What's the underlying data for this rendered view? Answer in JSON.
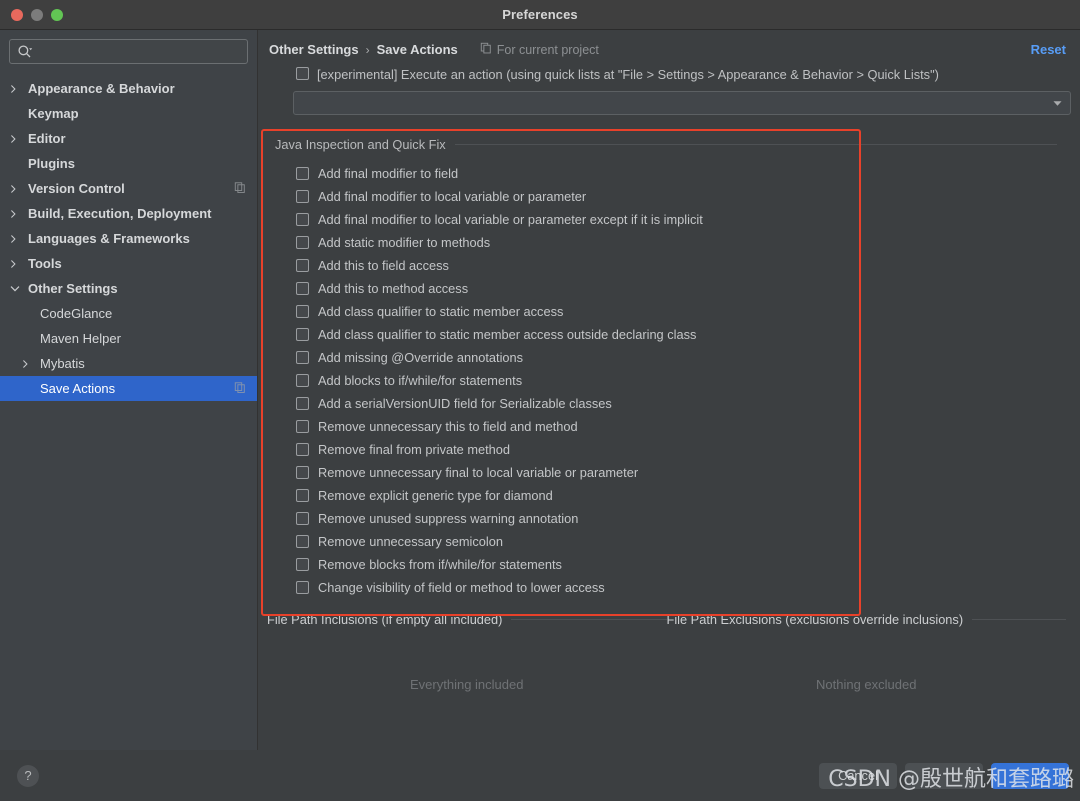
{
  "window": {
    "title": "Preferences",
    "traffic_lights": [
      "close-light",
      "minimize-light",
      "maximize-light"
    ]
  },
  "sidebar": {
    "search": {
      "value": "",
      "placeholder": "",
      "icon": "search-icon"
    },
    "items": [
      {
        "label": "Appearance & Behavior",
        "level": 1,
        "arrow": "chevron-right-icon",
        "bold": true,
        "selected": false,
        "badge": null
      },
      {
        "label": "Keymap",
        "level": 1,
        "arrow": null,
        "bold": true,
        "selected": false,
        "badge": null
      },
      {
        "label": "Editor",
        "level": 1,
        "arrow": "chevron-right-icon",
        "bold": true,
        "selected": false,
        "badge": null
      },
      {
        "label": "Plugins",
        "level": 1,
        "arrow": null,
        "bold": true,
        "selected": false,
        "badge": null
      },
      {
        "label": "Version Control",
        "level": 1,
        "arrow": "chevron-right-icon",
        "bold": true,
        "selected": false,
        "badge": "copy-icon"
      },
      {
        "label": "Build, Execution, Deployment",
        "level": 1,
        "arrow": "chevron-right-icon",
        "bold": true,
        "selected": false,
        "badge": null
      },
      {
        "label": "Languages & Frameworks",
        "level": 1,
        "arrow": "chevron-right-icon",
        "bold": true,
        "selected": false,
        "badge": null
      },
      {
        "label": "Tools",
        "level": 1,
        "arrow": "chevron-right-icon",
        "bold": true,
        "selected": false,
        "badge": null
      },
      {
        "label": "Other Settings",
        "level": 1,
        "arrow": "chevron-down-icon",
        "bold": true,
        "selected": false,
        "badge": null
      },
      {
        "label": "CodeGlance",
        "level": 2,
        "arrow": null,
        "bold": false,
        "selected": false,
        "badge": null
      },
      {
        "label": "Maven Helper",
        "level": 2,
        "arrow": null,
        "bold": false,
        "selected": false,
        "badge": null
      },
      {
        "label": "Mybatis",
        "level": 2,
        "arrow": "chevron-right-icon",
        "bold": false,
        "selected": false,
        "badge": null
      },
      {
        "label": "Save Actions",
        "level": 2,
        "arrow": null,
        "bold": false,
        "selected": true,
        "badge": "copy-icon"
      }
    ]
  },
  "content": {
    "breadcrumb": {
      "parent": "Other Settings",
      "separator": "›",
      "current": "Save Actions"
    },
    "for_current_project": {
      "label": "For current project",
      "icon": "copy-icon"
    },
    "reset_label": "Reset",
    "reset_color": "#589df6",
    "experimental": {
      "checked": false,
      "label": "[experimental] Execute an action (using quick lists at \"File > Settings > Appearance & Behavior > Quick Lists\")",
      "combo_value": "",
      "combo_icon": "chevron-down-icon"
    },
    "group": {
      "title": "Java Inspection and Quick Fix",
      "annotation_color": "#e8412a",
      "items": [
        {
          "label": "Add final modifier to field",
          "checked": false
        },
        {
          "label": "Add final modifier to local variable or parameter",
          "checked": false
        },
        {
          "label": "Add final modifier to local variable or parameter except if it is implicit",
          "checked": false
        },
        {
          "label": "Add static modifier to methods",
          "checked": false
        },
        {
          "label": "Add this to field access",
          "checked": false
        },
        {
          "label": "Add this to method access",
          "checked": false
        },
        {
          "label": "Add class qualifier to static member access",
          "checked": false
        },
        {
          "label": "Add class qualifier to static member access outside declaring class",
          "checked": false
        },
        {
          "label": "Add missing @Override annotations",
          "checked": false
        },
        {
          "label": "Add blocks to if/while/for statements",
          "checked": false
        },
        {
          "label": "Add a serialVersionUID field for Serializable classes",
          "checked": false
        },
        {
          "label": "Remove unnecessary this to field and method",
          "checked": false
        },
        {
          "label": "Remove final from private method",
          "checked": false
        },
        {
          "label": "Remove unnecessary final to local variable or parameter",
          "checked": false
        },
        {
          "label": "Remove explicit generic type for diamond",
          "checked": false
        },
        {
          "label": "Remove unused suppress warning annotation",
          "checked": false
        },
        {
          "label": "Remove unnecessary semicolon",
          "checked": false
        },
        {
          "label": "Remove blocks from if/while/for statements",
          "checked": false
        },
        {
          "label": "Change visibility of field or method to lower access",
          "checked": false
        }
      ]
    },
    "paths": {
      "inclusions": {
        "title": "File Path Inclusions (if empty all included)",
        "empty_text": "Everything included"
      },
      "exclusions": {
        "title": "File Path Exclusions (exclusions override inclusions)",
        "empty_text": "Nothing excluded"
      }
    }
  },
  "footer": {
    "help_label": "?",
    "buttons": [
      {
        "label": "Cancel",
        "primary": false
      },
      {
        "label": "",
        "primary": false
      },
      {
        "label": "",
        "primary": true
      }
    ]
  },
  "watermark": {
    "text": "CSDN @殷世航和套路璐"
  }
}
